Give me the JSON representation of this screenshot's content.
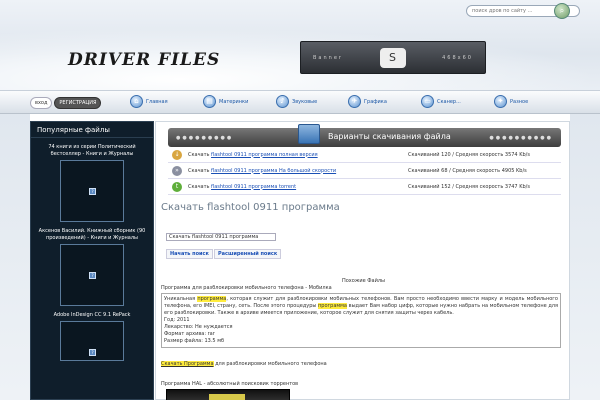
{
  "header": {
    "search_placeholder": "поиск дров по сайту ...",
    "logo": "DRIVER FILES",
    "banner_left": "Banner",
    "banner_right": "468x60"
  },
  "nav": {
    "login": "вход",
    "register": "РЕГИСТРАЦИЯ",
    "items": [
      {
        "label": "Главная",
        "icon": "home-icon"
      },
      {
        "label": "Материнки",
        "icon": "motherboard-icon"
      },
      {
        "label": "Звуковые",
        "icon": "sound-icon"
      },
      {
        "label": "Графика",
        "icon": "graphics-icon"
      },
      {
        "label": "Сканер...",
        "icon": "scanner-icon"
      },
      {
        "label": "Разное",
        "icon": "misc-icon"
      }
    ]
  },
  "sidebar": {
    "title": "Популярные файлы",
    "items": [
      {
        "caption": "74 книги из серии Политический бестселлер - Книги и Журналы"
      },
      {
        "caption": "Аксенов Василий. Книжный сборник (90 произведений) - Книги и Журналы"
      },
      {
        "caption": "Adobe InDesign CC 9.1 RePack"
      }
    ]
  },
  "downloads": {
    "header": "Варианты скачивания файла",
    "rows": [
      {
        "prefix": "Скачать",
        "link": "flashtool 0911 программа полная версия",
        "stats": "Скачиваний 120 / Средняя скорость 3574 Kb/s"
      },
      {
        "prefix": "Скачать",
        "link": "flashtool 0911 программа На большой скорости",
        "stats": "Скачиваний 68 / Средняя скорость 4905 Kb/s"
      },
      {
        "prefix": "Скачать",
        "link": "flashtool 0911 программа torrent",
        "stats": "Скачиваний 152 / Средняя скорость 3747 Kb/s"
      }
    ]
  },
  "main": {
    "title": "Скачать flashtool 0911 программа",
    "search_value": "Скачать flashtool 0911 программа",
    "start_search": "Начать поиск",
    "advanced_search": "Расширенный поиск",
    "similar_heading": "Похожие Файлы",
    "item1_title": "Программа для разблокировки мобильного телефона - Мобилка",
    "item1_desc_1": "Уникальная ",
    "item1_hl_1": "программа",
    "item1_desc_2": ", которая служит для разблокировки мобильных телефонов. Вам просто необходимо ввести марку и модель мобильного телефона, его IMEI, страну, сеть. После этого процедуры ",
    "item1_hl_2": "программа",
    "item1_desc_3": " выдает Вам набор цифр, которые нужно набрать на мобильном телефоне для его разблокировки. Также в архиве имеется приложение, которое служит для снятия защиты через кабель.",
    "item1_year": "Год: 2011",
    "item1_cure": "Лекарство: Не нуждается",
    "item1_format": "Формат архива: rar",
    "item1_size": "Размер файла: 13.5 мб",
    "item1_link_hl": "Скачать Программа",
    "item1_link_rest": " для разблокировки мобильного телефона",
    "item2_title": "Программа HAL - абсолютный поисковик торрентов"
  }
}
